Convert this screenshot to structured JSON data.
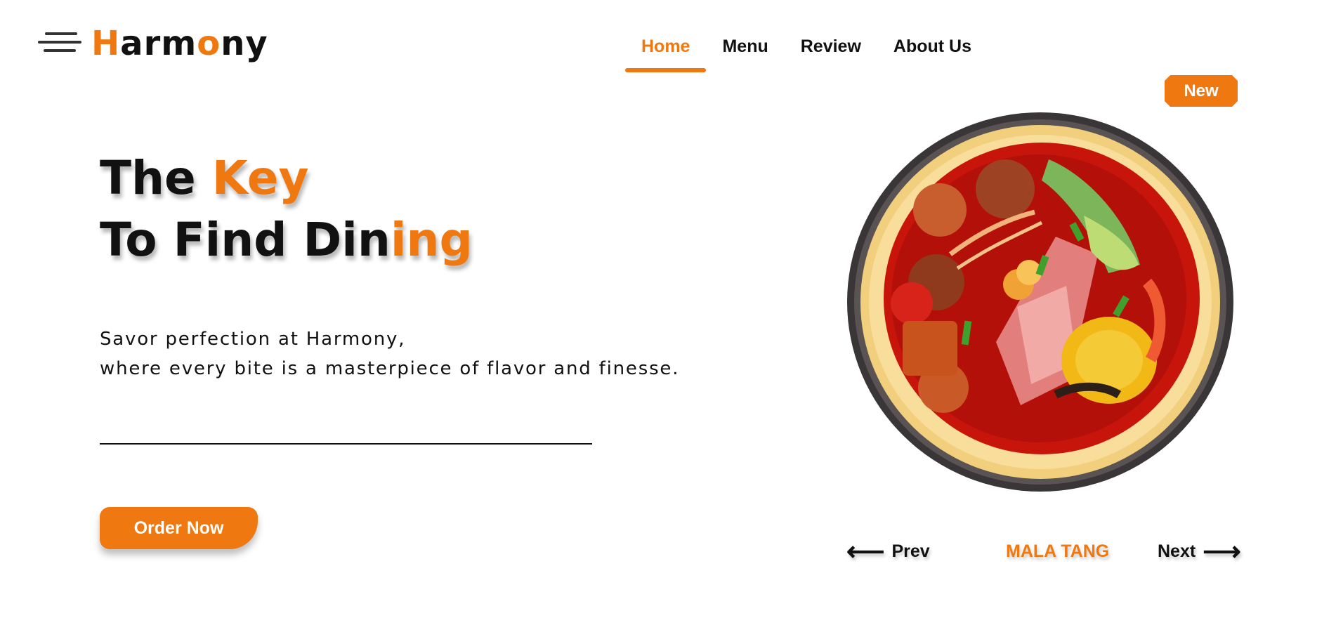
{
  "header": {
    "logo_parts": [
      {
        "text": "H",
        "accent": true
      },
      {
        "text": "arm",
        "accent": false
      },
      {
        "text": "o",
        "accent": true
      },
      {
        "text": "ny",
        "accent": false
      }
    ],
    "nav": [
      {
        "label": "Home",
        "active": true
      },
      {
        "label": "Menu",
        "active": false
      },
      {
        "label": "Review",
        "active": false
      },
      {
        "label": "About Us",
        "active": false
      }
    ]
  },
  "hero": {
    "line1_plain": "The ",
    "line1_accent": "Key",
    "line2_plain": "To Find Din",
    "line2_accent": "ing",
    "desc_line1": "Savor perfection at Harmony,",
    "desc_line2": "where every bite is a masterpiece of flavor and finesse.",
    "cta": "Order Now"
  },
  "showcase": {
    "badge": "New",
    "prev_label": "Prev",
    "next_label": "Next",
    "dish_name": "MALA TANG",
    "image_icon": "mala-tang-bowl-image"
  },
  "colors": {
    "accent": "#f07810",
    "text": "#111111",
    "background": "#ffffff"
  }
}
